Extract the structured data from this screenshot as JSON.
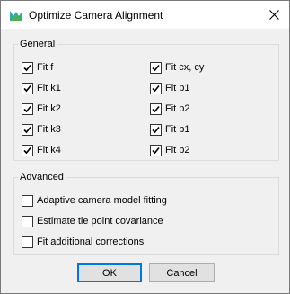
{
  "dialog": {
    "title": "Optimize Camera Alignment"
  },
  "general": {
    "legend": "General",
    "left": [
      {
        "label": "Fit f",
        "checked": true
      },
      {
        "label": "Fit k1",
        "checked": true
      },
      {
        "label": "Fit k2",
        "checked": true
      },
      {
        "label": "Fit k3",
        "checked": true
      },
      {
        "label": "Fit k4",
        "checked": true
      }
    ],
    "right": [
      {
        "label": "Fit cx, cy",
        "checked": true
      },
      {
        "label": "Fit p1",
        "checked": true
      },
      {
        "label": "Fit p2",
        "checked": true
      },
      {
        "label": "Fit b1",
        "checked": true
      },
      {
        "label": "Fit b2",
        "checked": true
      }
    ]
  },
  "advanced": {
    "legend": "Advanced",
    "items": [
      {
        "label": "Adaptive camera model fitting",
        "checked": false
      },
      {
        "label": "Estimate tie point covariance",
        "checked": false
      },
      {
        "label": "Fit additional corrections",
        "checked": false
      }
    ]
  },
  "buttons": {
    "ok": "OK",
    "cancel": "Cancel"
  }
}
